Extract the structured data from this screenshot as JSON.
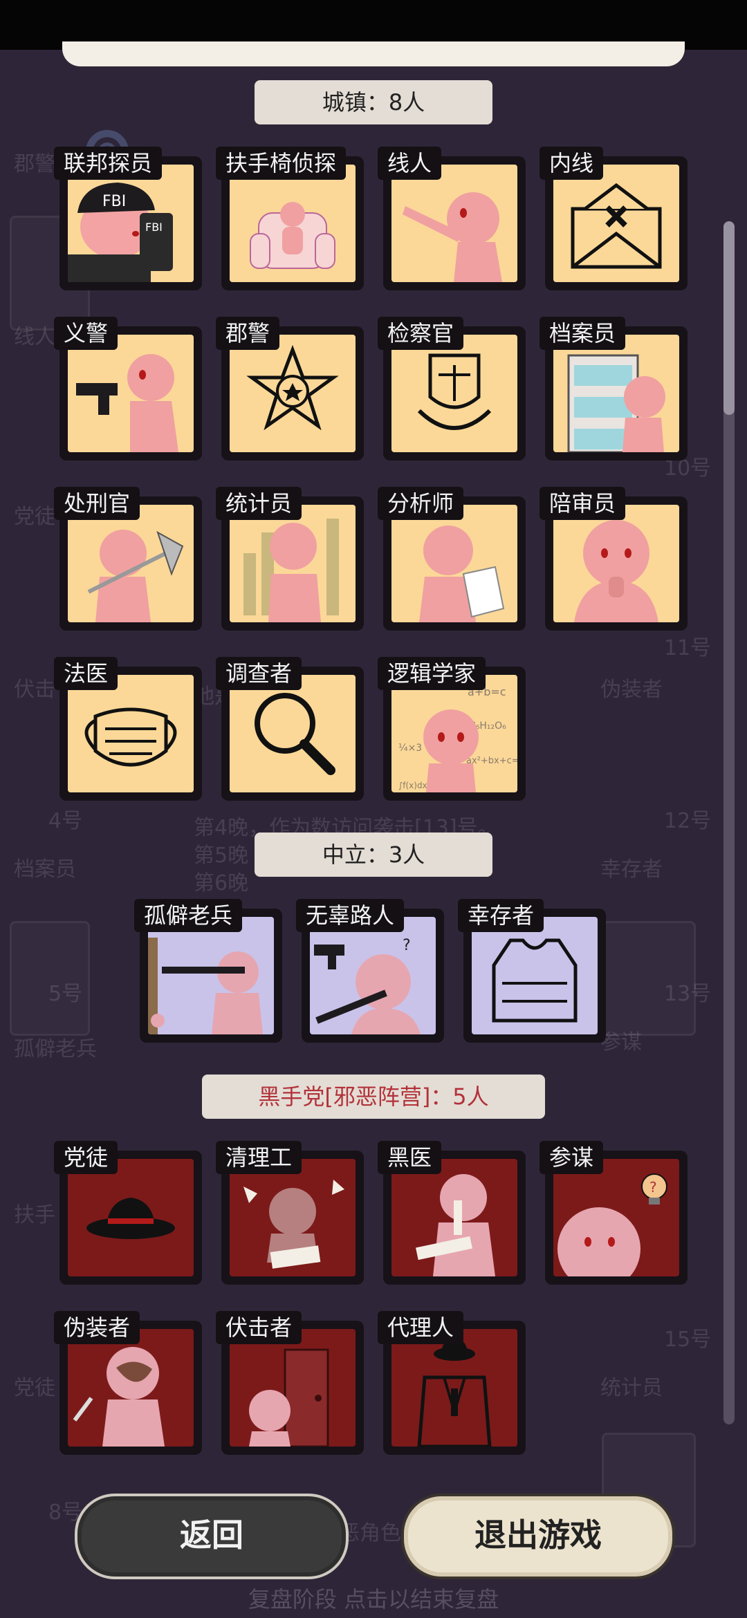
{
  "sections": {
    "town": {
      "label": "城镇：8人"
    },
    "neutral": {
      "label": "中立：3人"
    },
    "mafia": {
      "label": "黑手党[邪恶阵营]：5人"
    }
  },
  "roles": {
    "town": [
      {
        "name": "联邦探员",
        "icon": "fbi-agent-icon",
        "art_text": "FBI"
      },
      {
        "name": "扶手椅侦探",
        "icon": "armchair-detective-icon"
      },
      {
        "name": "线人",
        "icon": "informant-pointing-icon"
      },
      {
        "name": "内线",
        "icon": "envelope-x-icon"
      },
      {
        "name": "义警",
        "icon": "vigilante-gun-icon"
      },
      {
        "name": "郡警",
        "icon": "sheriff-star-badge-icon"
      },
      {
        "name": "检察官",
        "icon": "prosecutor-scales-icon"
      },
      {
        "name": "档案员",
        "icon": "archivist-bookshelf-icon"
      },
      {
        "name": "处刑官",
        "icon": "executioner-axe-icon"
      },
      {
        "name": "统计员",
        "icon": "statistician-chart-icon"
      },
      {
        "name": "分析师",
        "icon": "analyst-paper-icon"
      },
      {
        "name": "陪审员",
        "icon": "juror-praying-icon"
      },
      {
        "name": "法医",
        "icon": "coroner-mask-icon"
      },
      {
        "name": "调查者",
        "icon": "investigator-magnifier-icon"
      },
      {
        "name": "逻辑学家",
        "icon": "logician-formula-icon",
        "art_text": [
          "a+b=c",
          "C₆H₁₂O₆",
          "ax²+bx+c=0",
          "∫f(x)dx = F(b)-F(a)",
          "¼×3"
        ]
      }
    ],
    "neutral": [
      {
        "name": "孤僻老兵",
        "icon": "reclusive-veteran-icon"
      },
      {
        "name": "无辜路人",
        "icon": "innocent-bystander-icon",
        "art_text": "?"
      },
      {
        "name": "幸存者",
        "icon": "survivor-vest-icon"
      }
    ],
    "mafia": [
      {
        "name": "党徒",
        "icon": "fedora-hat-icon"
      },
      {
        "name": "清理工",
        "icon": "cleaner-icon"
      },
      {
        "name": "黑医",
        "icon": "black-doctor-icon"
      },
      {
        "name": "参谋",
        "icon": "strategist-lightbulb-icon",
        "art_text": "?"
      },
      {
        "name": "伪装者",
        "icon": "disguiser-mask-icon"
      },
      {
        "name": "伏击者",
        "icon": "ambusher-door-icon"
      },
      {
        "name": "代理人",
        "icon": "proxy-suit-icon"
      }
    ]
  },
  "buttons": {
    "back": "返回",
    "exit": "退出游戏"
  },
  "background": {
    "left_labels": [
      "郡警",
      "线人",
      "党徒",
      "伏击",
      "档案员",
      "孤僻老兵",
      "扶手",
      "党徒"
    ],
    "right_labels": [
      "伪装者",
      "幸存者",
      "参谋",
      "统计员"
    ],
    "numbers": [
      "4号",
      "5号",
      "8号",
      "10号",
      "11号",
      "12号",
      "13号",
      "15号"
    ],
    "log_lines": [
      "第4晚，作为数访问袭击[13]号。",
      "第5晚",
      "第6晚",
      "他是黑手党的",
      "你清除了所有邪恶角色，因此获胜。"
    ],
    "hint": "复盘阶段 点击以结束复盘"
  },
  "colors": {
    "town_bg": "#fbd898",
    "neutral_bg": "#c9c3ea",
    "mafia_bg": "#7c1a1a",
    "mafia_label": "#b2323a"
  }
}
